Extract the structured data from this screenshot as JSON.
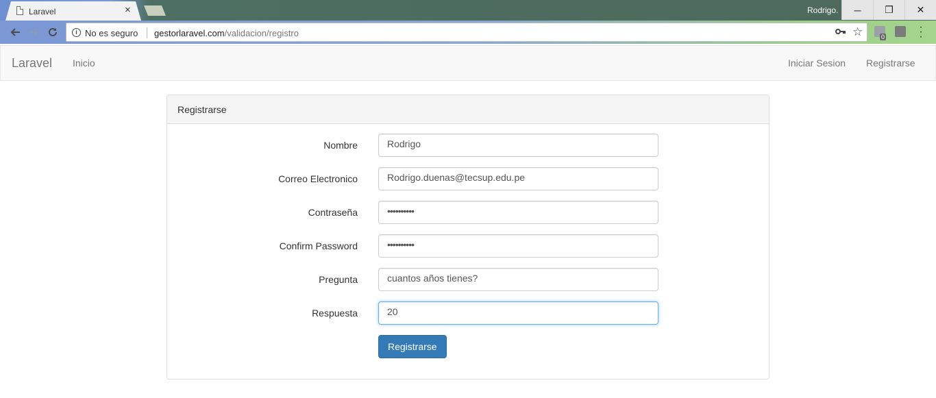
{
  "browser": {
    "tab_title": "Laravel",
    "tab_close": "×",
    "user_name": "Rodrigo.",
    "window_buttons": {
      "minimize": "─",
      "restore": "❐",
      "close": "✕"
    },
    "security_label": "No es seguro",
    "url_host": "gestorlaravel.com",
    "url_path": "/validacion/registro",
    "extension_badge": "0"
  },
  "navbar": {
    "brand": "Laravel",
    "links": {
      "home": "Inicio",
      "login": "Iniciar Sesion",
      "register": "Registrarse"
    }
  },
  "panel": {
    "heading": "Registrarse",
    "fields": [
      {
        "label": "Nombre",
        "value": "Rodrigo"
      },
      {
        "label": "Correo Electronico",
        "value": "Rodrigo.duenas@tecsup.edu.pe"
      },
      {
        "label": "Contraseña",
        "value": "••••••••••"
      },
      {
        "label": "Confirm Password",
        "value": "••••••••••"
      },
      {
        "label": "Pregunta",
        "value": "cuantos años tienes?"
      },
      {
        "label": "Respuesta",
        "value": "20"
      }
    ],
    "submit_label": "Registrarse"
  }
}
